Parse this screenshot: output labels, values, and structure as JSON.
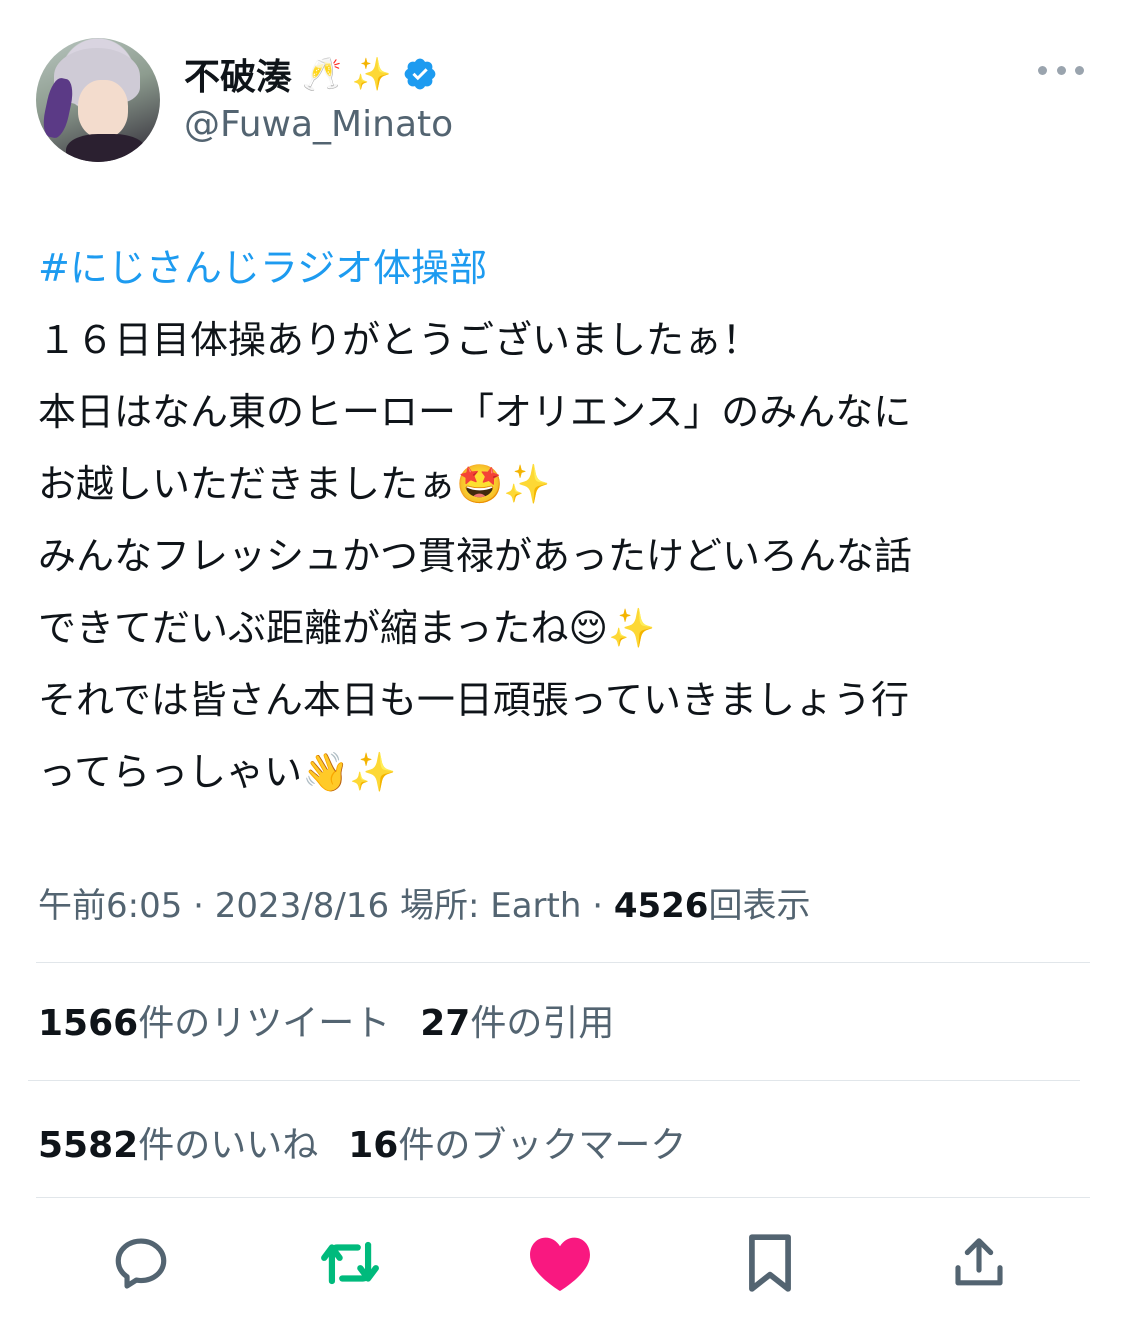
{
  "header": {
    "display_name": "不破湊",
    "name_emoji_1": "🥂",
    "name_emoji_2": "✨",
    "handle": "@Fuwa_Minato",
    "verified_icon": "verified-badge-icon",
    "more_icon": "more-dots-icon"
  },
  "tweet": {
    "hashtag": "#にじさんじラジオ体操部",
    "lines": [
      "１６日目体操ありがとうございましたぁ！",
      "本日はなん東のヒーロー「オリエンス」のみんなに",
      "お越しいただきましたぁ🤩✨",
      "みんなフレッシュかつ貫禄があったけどいろんな話",
      "できてだいぶ距離が縮まったね😌✨",
      "それでは皆さん本日も一日頑張っていきましょう行",
      "ってらっしゃい👋✨"
    ]
  },
  "meta": {
    "time": "午前6:05",
    "sep1": " · ",
    "date": "2023/8/16",
    "location_label": " 場所: Earth",
    "sep2": " · ",
    "views": "4526",
    "views_label": "回表示"
  },
  "stats": {
    "retweets": "1566",
    "retweets_label": "件のリツイート",
    "quotes": "27",
    "quotes_label": "件の引用",
    "likes": "5582",
    "likes_label": "件のいいね",
    "bookmarks": "16",
    "bookmarks_label": "件のブックマーク"
  },
  "colors": {
    "link": "#1d9bf0",
    "retweet": "#00ba7c",
    "like": "#f91880",
    "icon": "#536471"
  }
}
